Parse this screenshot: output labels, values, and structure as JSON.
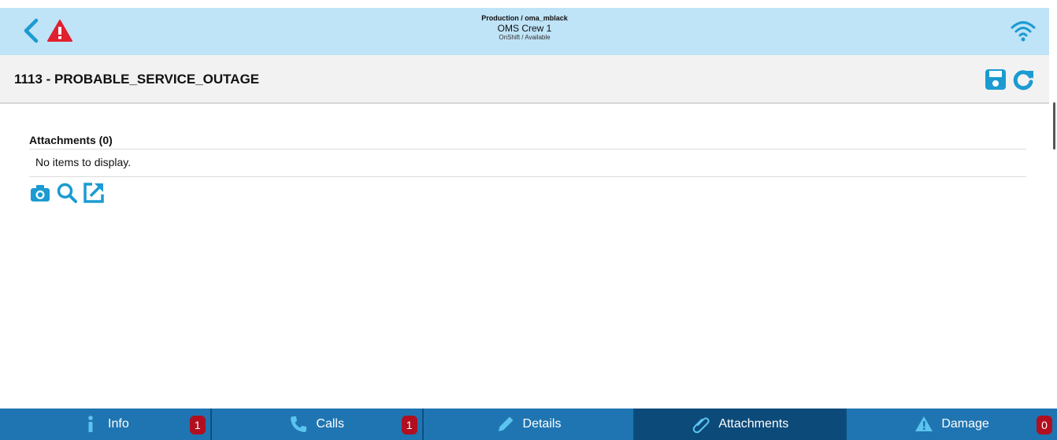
{
  "header": {
    "environment": "Production / oma_mblack",
    "crew_name": "OMS Crew 1",
    "crew_status": "OnShift / Available",
    "back_icon": "chevron-left-icon",
    "alert_icon": "warning-triangle-icon",
    "connection_icon": "wifi-icon"
  },
  "titlebar": {
    "title": "1113 - PROBABLE_SERVICE_OUTAGE",
    "save_icon": "save-icon",
    "refresh_icon": "refresh-icon"
  },
  "attachments": {
    "heading": "Attachments (0)",
    "empty_message": "No items to display.",
    "actions": [
      "camera-icon",
      "search-icon",
      "open-external-icon"
    ]
  },
  "tabs": [
    {
      "label": "Info",
      "icon": "info-icon",
      "badge": "1",
      "active": false
    },
    {
      "label": "Calls",
      "icon": "phone-icon",
      "badge": "1",
      "active": false
    },
    {
      "label": "Details",
      "icon": "pencil-icon",
      "badge": "",
      "active": false
    },
    {
      "label": "Attachments",
      "icon": "paperclip-icon",
      "badge": "",
      "active": true
    },
    {
      "label": "Damage",
      "icon": "warning-icon",
      "badge": "0",
      "active": false
    }
  ],
  "colors": {
    "header_bg": "#bfe3f7",
    "accent": "#1b9bd1",
    "alert": "#e0202f",
    "tabbar_bg": "#1f75b2",
    "tab_active_bg": "#0c4a7a",
    "badge_bg": "#b10f1f"
  }
}
